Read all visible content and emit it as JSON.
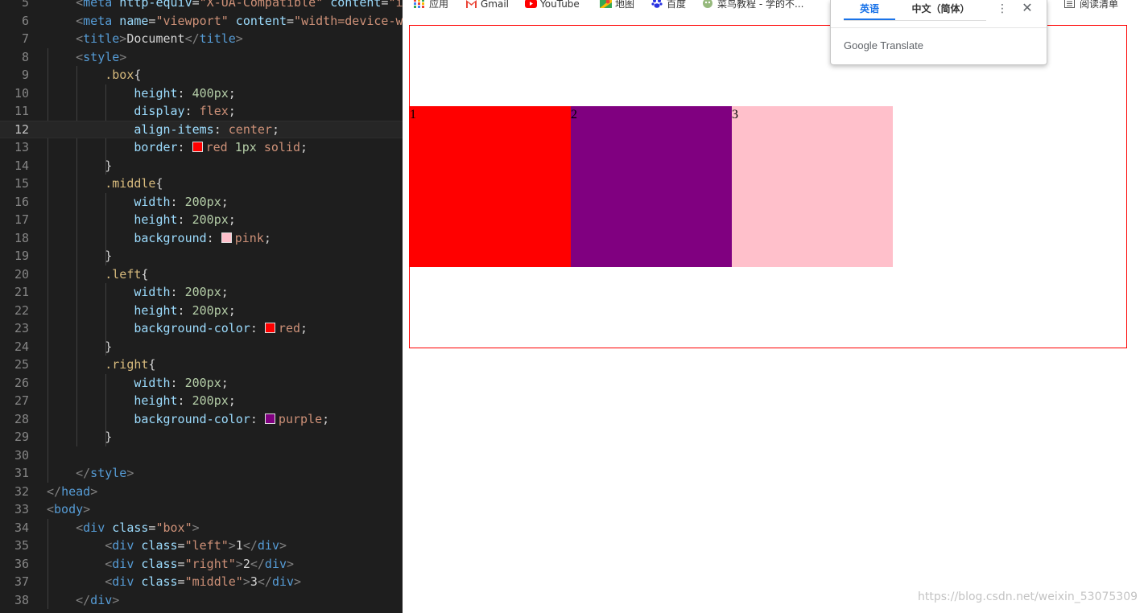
{
  "editor": {
    "lines": [
      {
        "num": "5",
        "code": "<meta http-equiv=\"X-UA-Compatible\" content=\"i"
      },
      {
        "num": "6",
        "code": "<meta name=\"viewport\" content=\"width=device-w"
      },
      {
        "num": "7",
        "code": "<title>Document</title>"
      },
      {
        "num": "8",
        "code": "<style>"
      },
      {
        "num": "9",
        "code": ".box{"
      },
      {
        "num": "10",
        "code": "height: 400px;"
      },
      {
        "num": "11",
        "code": "display: flex;"
      },
      {
        "num": "12",
        "code": "align-items: center;"
      },
      {
        "num": "13",
        "code": "border: red 1px solid;"
      },
      {
        "num": "14",
        "code": "}"
      },
      {
        "num": "15",
        "code": ".middle{"
      },
      {
        "num": "16",
        "code": "width: 200px;"
      },
      {
        "num": "17",
        "code": "height: 200px;"
      },
      {
        "num": "18",
        "code": "background: pink;"
      },
      {
        "num": "19",
        "code": "}"
      },
      {
        "num": "20",
        "code": ".left{"
      },
      {
        "num": "21",
        "code": "width: 200px;"
      },
      {
        "num": "22",
        "code": "height: 200px;"
      },
      {
        "num": "23",
        "code": "background-color: red;"
      },
      {
        "num": "24",
        "code": "}"
      },
      {
        "num": "25",
        "code": ".right{"
      },
      {
        "num": "26",
        "code": "width: 200px;"
      },
      {
        "num": "27",
        "code": "height: 200px;"
      },
      {
        "num": "28",
        "code": "background-color: purple;"
      },
      {
        "num": "29",
        "code": "}"
      },
      {
        "num": "30",
        "code": ""
      },
      {
        "num": "31",
        "code": "</style>"
      },
      {
        "num": "32",
        "code": "</head>"
      },
      {
        "num": "33",
        "code": "<body>"
      },
      {
        "num": "34",
        "code": "<div class=\"box\">"
      },
      {
        "num": "35",
        "code": "<div class=\"left\">1</div>"
      },
      {
        "num": "36",
        "code": "<div class=\"right\">2</div>"
      },
      {
        "num": "37",
        "code": "<div class=\"middle\">3</div>"
      },
      {
        "num": "38",
        "code": "</div>"
      }
    ],
    "active_line": "12",
    "swatch_colors": {
      "red": "#ff0000",
      "pink": "#ffc0cb",
      "purple": "#800080"
    }
  },
  "bookmarks": [
    {
      "label": "应用",
      "icon": "apps-grid-icon"
    },
    {
      "label": "Gmail",
      "icon": "gmail-icon"
    },
    {
      "label": "YouTube",
      "icon": "youtube-icon"
    },
    {
      "label": "地图",
      "icon": "maps-icon"
    },
    {
      "label": "百度",
      "icon": "baidu-icon"
    },
    {
      "label": "菜鸟教程 - 学的不...",
      "icon": "runoob-icon"
    },
    {
      "label": "阅读清单",
      "icon": "reading-list-icon"
    }
  ],
  "page": {
    "cells": [
      {
        "text": "1",
        "color": "#ff0000"
      },
      {
        "text": "2",
        "color": "#800080"
      },
      {
        "text": "3",
        "color": "#ffc0cb"
      }
    ],
    "box_border_color": "#ff0000"
  },
  "translate": {
    "tab_source": "英语",
    "tab_target": "中文（简体）",
    "brand": "Google Translate",
    "accent": "#1a73e8"
  },
  "watermark": "https://blog.csdn.net/weixin_53075309"
}
